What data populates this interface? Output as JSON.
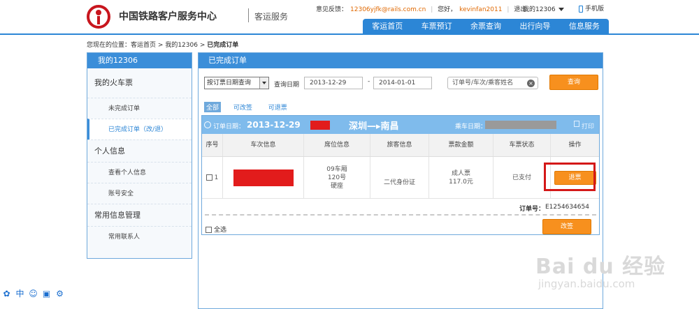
{
  "header": {
    "site_title": "中国铁路客户服务中心",
    "site_sub": "客运服务",
    "feedback_label": "意见反馈：",
    "feedback_email": "12306yjfk@rails.com.cn",
    "greeting": "您好，",
    "username": "kevinfan2011",
    "logout": "退出",
    "my12306": "我的12306",
    "mobile": "手机版",
    "nav": [
      "客运首页",
      "车票预订",
      "余票查询",
      "出行向导",
      "信息服务"
    ]
  },
  "breadcrumb": {
    "prefix": "您现在的位置：",
    "crumb1": "客运首页",
    "sep": ">",
    "crumb2": "我的12306",
    "current": "已完成订单"
  },
  "sidebar": {
    "title": "我的12306",
    "group1": "我的火车票",
    "item_uncompleted": "未完成订单",
    "item_completed": "已完成订单（改/退）",
    "group2": "个人信息",
    "item_view_info": "查看个人信息",
    "item_security": "账号安全",
    "group3": "常用信息管理",
    "item_contacts": "常用联系人"
  },
  "panel": {
    "title": "已完成订单",
    "query_type": "按订票日期查询",
    "query_date_label": "查询日期",
    "date_from": "2013-12-29",
    "date_sep": "-",
    "date_to": "2014-01-01",
    "search_placeholder": "订单号/车次/乘客姓名",
    "search_button": "查询",
    "filter_all": "全部",
    "filter_changeable": "可改签",
    "filter_refundable": "可退票"
  },
  "order": {
    "date_label": "订单日期：",
    "date": "2013-12-29",
    "route": "深圳—▸南昌",
    "ride_date_label": "乘车日期：",
    "print": "打印",
    "columns": [
      "序号",
      "车次信息",
      "席位信息",
      "旅客信息",
      "票款金额",
      "车票状态",
      "操作"
    ],
    "row": {
      "index": "1",
      "seat_car": "09车厢",
      "seat_no": "120号",
      "seat_type": "硬座",
      "passenger_id": "二代身份证",
      "ticket_type": "成人票",
      "price": "117.0元",
      "status": "已支付",
      "refund": "退票"
    },
    "order_no_label": "订单号：",
    "order_no": "E1254634654",
    "select_all": "全选",
    "change_button": "改签"
  },
  "tools": [
    "paw-icon",
    "chinese-input-icon",
    "smile-icon",
    "image-icon",
    "gear-icon"
  ],
  "watermark": {
    "main": "Bai du 经验",
    "sub": "jingyan.baidu.com"
  },
  "colors": {
    "primary_blue": "#2c86d6",
    "orange": "#f7901e",
    "highlight_red": "#d41818"
  }
}
